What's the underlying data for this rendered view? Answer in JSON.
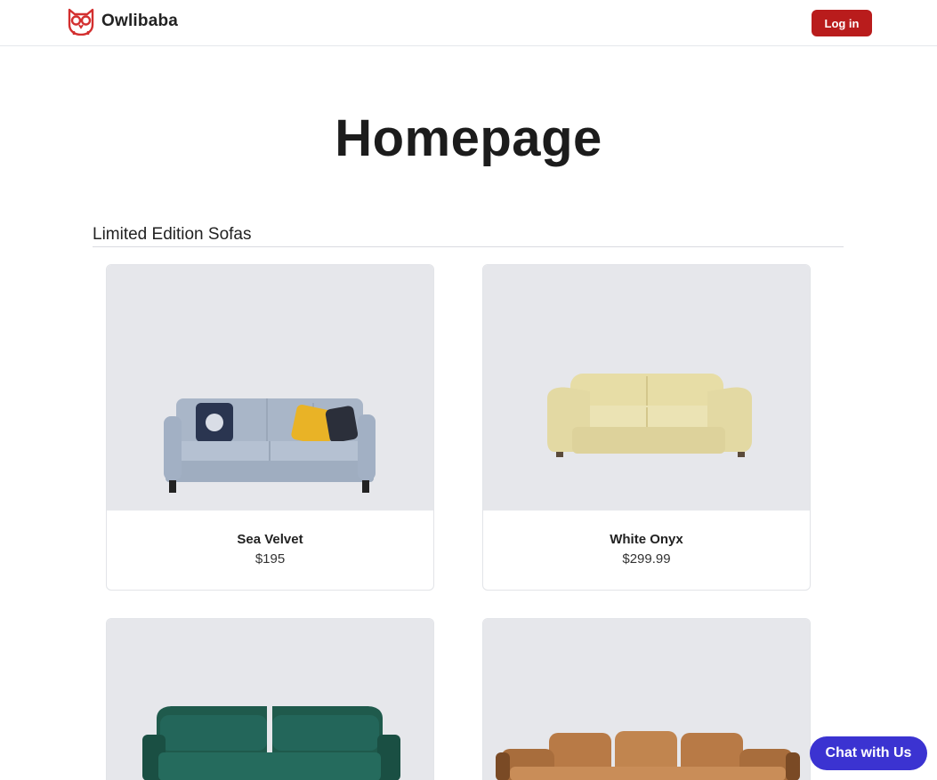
{
  "header": {
    "brand": "Owlibaba",
    "logo_icon": "owl-logo-icon",
    "login_label": "Log in",
    "accent_color": "#b91c1c"
  },
  "page": {
    "title": "Homepage"
  },
  "section": {
    "title": "Limited Edition Sofas"
  },
  "products": [
    {
      "name": "Sea Velvet",
      "price": "$195",
      "image": "light-blue-sofa-with-pillows"
    },
    {
      "name": "White Onyx",
      "price": "$299.99",
      "image": "cream-leather-sofa"
    },
    {
      "name": "",
      "price": "",
      "image": "dark-green-velvet-sofa"
    },
    {
      "name": "",
      "price": "",
      "image": "tan-leather-sofa"
    }
  ],
  "chat": {
    "label": "Chat with Us",
    "color": "#3b33d1"
  }
}
